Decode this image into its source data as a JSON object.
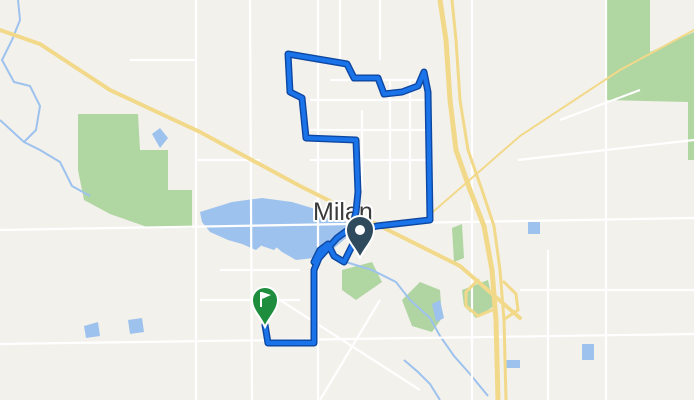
{
  "map": {
    "city_label": "Milan",
    "colors": {
      "background": "#f3f1ec",
      "park": "#a9d39a",
      "water": "#9ec2ee",
      "major_road": "#f2d98a",
      "minor_road": "#ffffff",
      "route": "#1a73e8",
      "route_casing": "#0d47a1",
      "start_marker": "#2f4a5c",
      "end_marker": "#1e8e3e"
    },
    "markers": {
      "start": {
        "icon": "location-pin-icon"
      },
      "end": {
        "icon": "finish-flag-icon"
      }
    }
  }
}
